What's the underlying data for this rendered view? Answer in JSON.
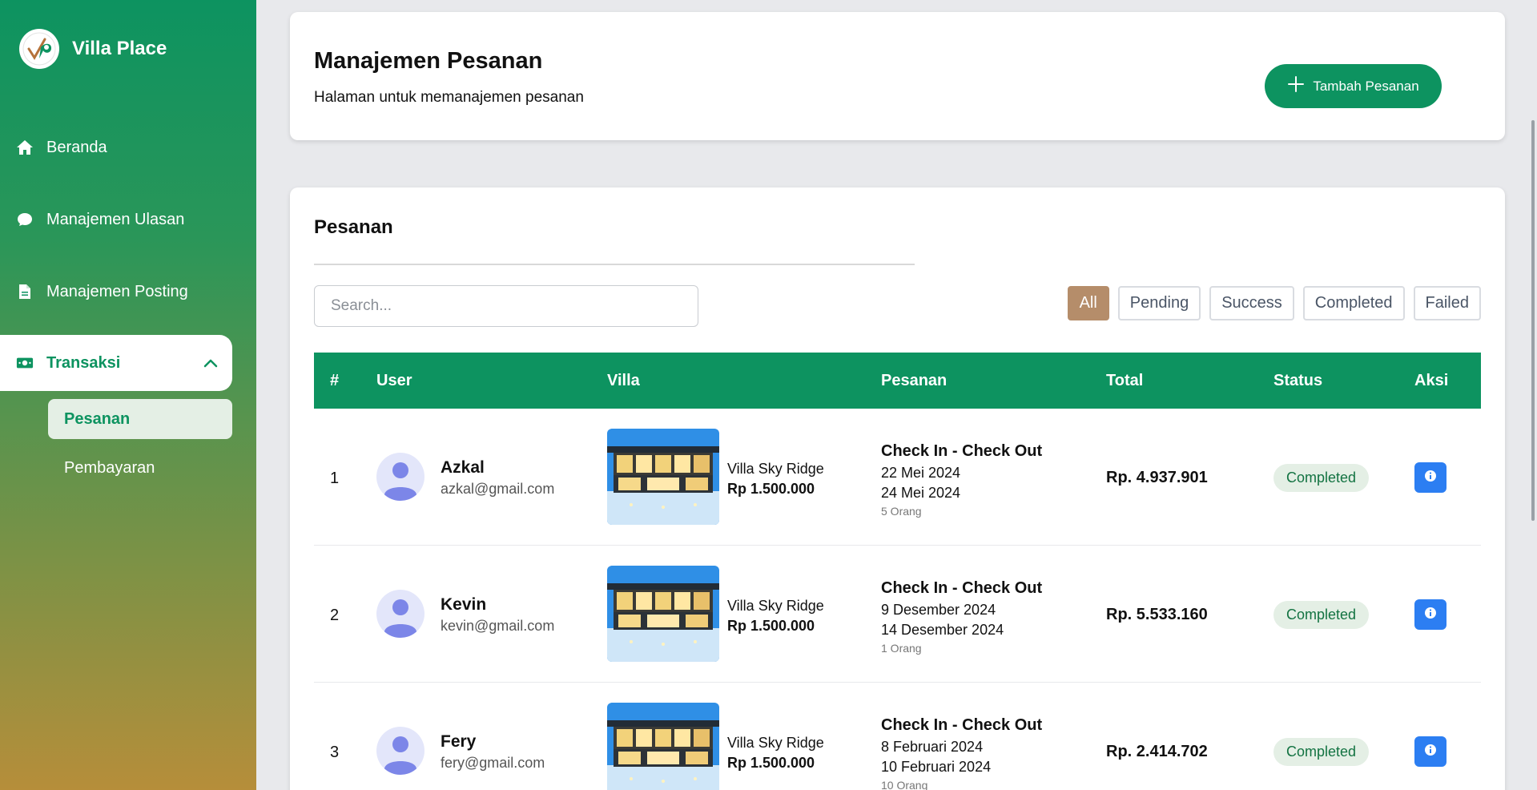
{
  "brand": {
    "name": "Villa Place",
    "logo_icon": "villa-place-logo"
  },
  "sidebar": {
    "items": [
      {
        "label": "Beranda",
        "icon": "home-icon"
      },
      {
        "label": "Manajemen Ulasan",
        "icon": "chat-bubble-icon"
      },
      {
        "label": "Manajemen Posting",
        "icon": "document-icon"
      },
      {
        "label": "Transaksi",
        "icon": "money-icon",
        "expanded": true
      }
    ],
    "subitems": [
      {
        "label": "Pesanan",
        "active": true
      },
      {
        "label": "Pembayaran",
        "active": false
      }
    ]
  },
  "header": {
    "title": "Manajemen Pesanan",
    "subtitle": "Halaman untuk memanajemen pesanan",
    "add_button_label": "Tambah Pesanan"
  },
  "orders": {
    "title": "Pesanan",
    "search_placeholder": "Search...",
    "filters": [
      "All",
      "Pending",
      "Success",
      "Completed",
      "Failed"
    ],
    "active_filter": "All",
    "columns": [
      "#",
      "User",
      "Villa",
      "Pesanan",
      "Total",
      "Status",
      "Aksi"
    ],
    "rows": [
      {
        "num": "1",
        "name": "Azkal",
        "email": "azkal@gmail.com",
        "villa_name": "Villa Sky Ridge",
        "villa_price": "Rp 1.500.000",
        "pesanan_title": "Check In - Check Out",
        "check_in": "22 Mei 2024",
        "check_out": "24 Mei 2024",
        "guests": "5 Orang",
        "total": "Rp. 4.937.901",
        "status": "Completed"
      },
      {
        "num": "2",
        "name": "Kevin",
        "email": "kevin@gmail.com",
        "villa_name": "Villa Sky Ridge",
        "villa_price": "Rp 1.500.000",
        "pesanan_title": "Check In - Check Out",
        "check_in": "9 Desember 2024",
        "check_out": "14 Desember 2024",
        "guests": "1 Orang",
        "total": "Rp. 5.533.160",
        "status": "Completed"
      },
      {
        "num": "3",
        "name": "Fery",
        "email": "fery@gmail.com",
        "villa_name": "Villa Sky Ridge",
        "villa_price": "Rp 1.500.000",
        "pesanan_title": "Check In - Check Out",
        "check_in": "8 Februari 2024",
        "check_out": "10 Februari 2024",
        "guests": "10 Orang",
        "total": "Rp. 2.414.702",
        "status": "Completed"
      }
    ]
  },
  "colors": {
    "primary": "#0d9360",
    "filter_active": "#b58d6a",
    "info_button": "#2c7ef2",
    "status_bg": "#e4efe5"
  }
}
